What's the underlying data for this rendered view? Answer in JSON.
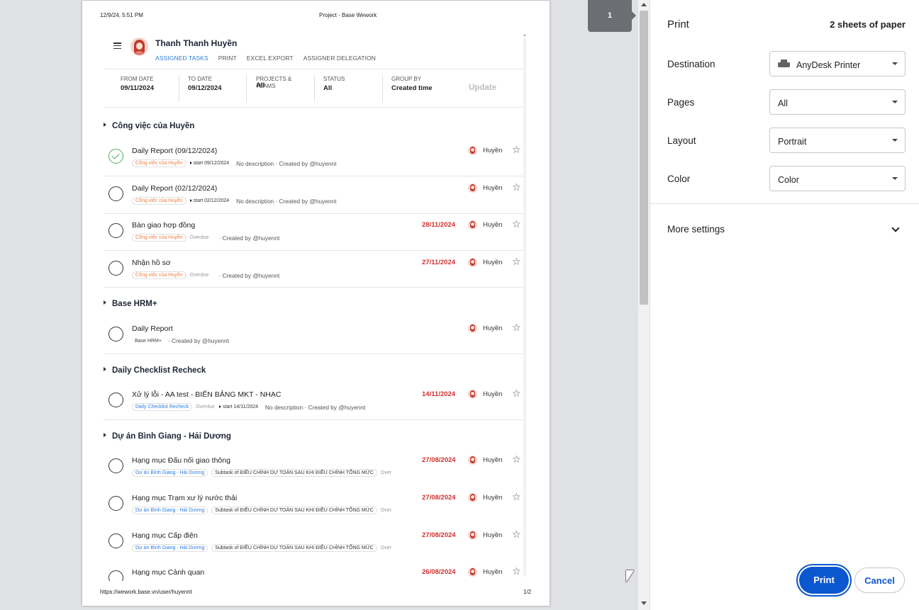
{
  "preview": {
    "header_date": "12/9/24, 5:51 PM",
    "header_title": "Project - Base Wework",
    "footer_url": "https://wework.base.vn/user/huyennt",
    "footer_page": "1/2",
    "user_name": "Thanh Thanh Huyền",
    "tabs": [
      "ASSIGNED TASKS",
      "PRINT",
      "EXCEL EXPORT",
      "ASSIGNER DELEGATION"
    ],
    "filters": [
      {
        "label": "FROM DATE",
        "value": "09/11/2024"
      },
      {
        "label": "TO DATE",
        "value": "09/12/2024"
      },
      {
        "label": "PROJECTS & TEAMS",
        "value": "All"
      },
      {
        "label": "STATUS",
        "value": "All"
      },
      {
        "label": "GROUP BY",
        "value": "Created time"
      }
    ],
    "update_label": "Update",
    "groups": [
      {
        "title": "Công việc của Huyền"
      },
      {
        "title": "Base HRM+"
      },
      {
        "title": "Daily Checklist Recheck"
      },
      {
        "title": "Dự án Bình Giang - Hải Dương"
      }
    ],
    "tasks": [
      {
        "name": "Daily Report (09/12/2024)",
        "tag": "Công việc của Huyền",
        "overdue": "",
        "start": "start 09/12/2024",
        "desc": "No description · Created by @huyennt",
        "due": "",
        "assignee": "Huyền",
        "done": true
      },
      {
        "name": "Daily Report (02/12/2024)",
        "tag": "Công việc của Huyền",
        "overdue": "",
        "start": "start 02/12/2024",
        "desc": "No description · Created by @huyennt",
        "due": "",
        "assignee": "Huyền"
      },
      {
        "name": "Bàn giao hợp đồng",
        "tag": "Công việc của Huyền",
        "overdue": "Overdue",
        "start": "",
        "desc": "· Created by @huyennt",
        "due": "28/11/2024",
        "assignee": "Huyền"
      },
      {
        "name": "Nhận hồ sơ",
        "tag": "Công việc của Huyền",
        "overdue": "Overdue",
        "start": "",
        "desc": "· Created by @huyennt",
        "due": "27/11/2024",
        "assignee": "Huyền"
      },
      {
        "name": "Daily Report",
        "tag": "Base HRM+",
        "overdue": "",
        "start": "",
        "desc": "· Created by @huyennt",
        "due": "",
        "assignee": "Huyền"
      },
      {
        "name": "Xử lý lỗi - AA test - BIỂN BẢNG MKT - NHẠC",
        "tag": "Daily Checklist Recheck",
        "overdue": "Overdue",
        "start": "start 14/11/2024",
        "desc": "No description · Created by @huyennt",
        "due": "14/11/2024",
        "assignee": "Huyền"
      },
      {
        "name": "Hạng mục Đấu nối giao thông",
        "tag": "Dự án Bình Giang - Hải Dương",
        "subtask": "Subtask of ĐIỀU CHỈNH DỰ TOÁN SAU KHI ĐIỀU CHỈNH TỔNG MỨC",
        "overdue": "Over",
        "due": "27/08/2024",
        "assignee": "Huyền"
      },
      {
        "name": "Hạng mục Trạm xư lý nước thải",
        "tag": "Dự án Bình Giang - Hải Dương",
        "subtask": "Subtask of ĐIỀU CHỈNH DỰ TOÁN SAU KHI ĐIỀU CHỈNH TỔNG MỨC",
        "overdue": "Over",
        "due": "27/08/2024",
        "assignee": "Huyền"
      },
      {
        "name": "Hạng mục Cấp điện",
        "tag": "Dự án Bình Giang - Hải Dương",
        "subtask": "Subtask of ĐIỀU CHỈNH DỰ TOÁN SAU KHI ĐIỀU CHỈNH TỔNG MỨC",
        "overdue": "Over",
        "due": "27/08/2024",
        "assignee": "Huyền"
      },
      {
        "name": "Hạng mục Cảnh quan",
        "due": "26/08/2024",
        "assignee": "Huyền"
      }
    ]
  },
  "page_badge": "1",
  "panel": {
    "title": "Print",
    "sheets": "2 sheets of paper",
    "destination_label": "Destination",
    "destination_value": "AnyDesk Printer",
    "pages_label": "Pages",
    "pages_value": "All",
    "layout_label": "Layout",
    "layout_value": "Portrait",
    "color_label": "Color",
    "color_value": "Color",
    "more_settings": "More settings",
    "print_button": "Print",
    "cancel_button": "Cancel"
  },
  "colors": {
    "accent": "#0b57d0",
    "due": "#d32f2f",
    "tag_orange": "#ef7d3c",
    "tag_blue": "#2a7be0",
    "done": "#4caf50"
  },
  "icons": [
    "menu-icon",
    "avatar",
    "checkbox-circle-icon",
    "star-icon",
    "printer-icon",
    "chevron-down-icon",
    "dropdown-arrow-icon",
    "mouse-cursor"
  ]
}
